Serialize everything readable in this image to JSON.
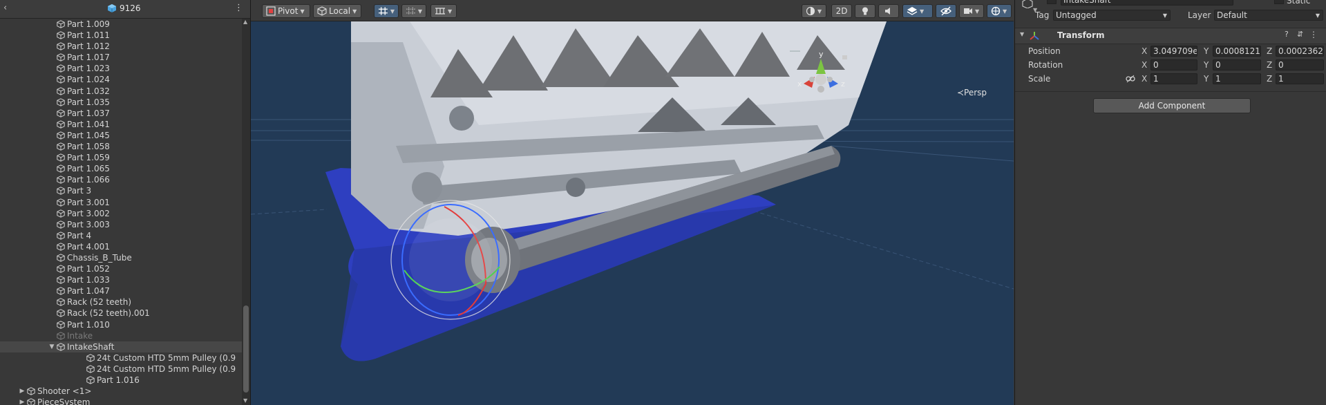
{
  "hierarchy": {
    "title": "9126",
    "back_glyph": "‹",
    "menu_glyph": "⋮",
    "rows": [
      {
        "label": "Part 1.009",
        "indent": 2,
        "expand": "none",
        "selected": false,
        "dim": false
      },
      {
        "label": "Part 1.011",
        "indent": 2,
        "expand": "none",
        "selected": false,
        "dim": false
      },
      {
        "label": "Part 1.012",
        "indent": 2,
        "expand": "none",
        "selected": false,
        "dim": false
      },
      {
        "label": "Part 1.017",
        "indent": 2,
        "expand": "none",
        "selected": false,
        "dim": false
      },
      {
        "label": "Part 1.023",
        "indent": 2,
        "expand": "none",
        "selected": false,
        "dim": false
      },
      {
        "label": "Part 1.024",
        "indent": 2,
        "expand": "none",
        "selected": false,
        "dim": false
      },
      {
        "label": "Part 1.032",
        "indent": 2,
        "expand": "none",
        "selected": false,
        "dim": false
      },
      {
        "label": "Part 1.035",
        "indent": 2,
        "expand": "none",
        "selected": false,
        "dim": false
      },
      {
        "label": "Part 1.037",
        "indent": 2,
        "expand": "none",
        "selected": false,
        "dim": false
      },
      {
        "label": "Part 1.041",
        "indent": 2,
        "expand": "none",
        "selected": false,
        "dim": false
      },
      {
        "label": "Part 1.045",
        "indent": 2,
        "expand": "none",
        "selected": false,
        "dim": false
      },
      {
        "label": "Part 1.058",
        "indent": 2,
        "expand": "none",
        "selected": false,
        "dim": false
      },
      {
        "label": "Part 1.059",
        "indent": 2,
        "expand": "none",
        "selected": false,
        "dim": false
      },
      {
        "label": "Part 1.065",
        "indent": 2,
        "expand": "none",
        "selected": false,
        "dim": false
      },
      {
        "label": "Part 1.066",
        "indent": 2,
        "expand": "none",
        "selected": false,
        "dim": false
      },
      {
        "label": "Part 3",
        "indent": 2,
        "expand": "none",
        "selected": false,
        "dim": false
      },
      {
        "label": "Part 3.001",
        "indent": 2,
        "expand": "none",
        "selected": false,
        "dim": false
      },
      {
        "label": "Part 3.002",
        "indent": 2,
        "expand": "none",
        "selected": false,
        "dim": false
      },
      {
        "label": "Part 3.003",
        "indent": 2,
        "expand": "none",
        "selected": false,
        "dim": false
      },
      {
        "label": "Part 4",
        "indent": 2,
        "expand": "none",
        "selected": false,
        "dim": false
      },
      {
        "label": "Part 4.001",
        "indent": 2,
        "expand": "none",
        "selected": false,
        "dim": false
      },
      {
        "label": "Chassis_B_Tube",
        "indent": 2,
        "expand": "none",
        "selected": false,
        "dim": false
      },
      {
        "label": "Part 1.052",
        "indent": 2,
        "expand": "none",
        "selected": false,
        "dim": false
      },
      {
        "label": "Part 1.033",
        "indent": 2,
        "expand": "none",
        "selected": false,
        "dim": false
      },
      {
        "label": "Part 1.047",
        "indent": 2,
        "expand": "none",
        "selected": false,
        "dim": false
      },
      {
        "label": "Rack (52 teeth)",
        "indent": 2,
        "expand": "none",
        "selected": false,
        "dim": false
      },
      {
        "label": "Rack (52 teeth).001",
        "indent": 2,
        "expand": "none",
        "selected": false,
        "dim": false
      },
      {
        "label": "Part 1.010",
        "indent": 2,
        "expand": "none",
        "selected": false,
        "dim": false
      },
      {
        "label": "Intake",
        "indent": 2,
        "expand": "none",
        "selected": false,
        "dim": true
      },
      {
        "label": "IntakeShaft",
        "indent": 2,
        "expand": "expanded",
        "selected": true,
        "dim": false
      },
      {
        "label": "24t Custom HTD 5mm Pulley (0.9",
        "indent": 3,
        "expand": "none",
        "selected": false,
        "dim": false
      },
      {
        "label": "24t Custom HTD 5mm Pulley (0.9",
        "indent": 3,
        "expand": "none",
        "selected": false,
        "dim": false
      },
      {
        "label": "Part 1.016",
        "indent": 3,
        "expand": "none",
        "selected": false,
        "dim": false
      },
      {
        "label": "Shooter <1>",
        "indent": 1,
        "expand": "collapsed",
        "selected": false,
        "dim": false
      },
      {
        "label": "PieceSystem",
        "indent": 1,
        "expand": "collapsed",
        "selected": false,
        "dim": false
      }
    ]
  },
  "scene": {
    "toolbar": {
      "pivot_label": "Pivot",
      "local_label": "Local",
      "mode_2d_label": "2D"
    },
    "persp_label": "≺Persp",
    "gizmo_axes": {
      "x": "x",
      "y": "y",
      "z": "z"
    },
    "colors": {
      "background": "#223a56",
      "ground": "#2e3fc0",
      "model": "#c9ced6"
    }
  },
  "inspector": {
    "object_name": "IntakeShaft",
    "static_label": "Static",
    "tag_label": "Tag",
    "tag_value": "Untagged",
    "layer_label": "Layer",
    "layer_value": "Default",
    "transform": {
      "title": "Transform",
      "position": {
        "label": "Position",
        "x": "3.049709e",
        "y": "0.0008121€",
        "z": "0.0002362"
      },
      "rotation": {
        "label": "Rotation",
        "x": "0",
        "y": "0",
        "z": "0"
      },
      "scale": {
        "label": "Scale",
        "x": "1",
        "y": "1",
        "z": "1"
      },
      "axis_x": "X",
      "axis_y": "Y",
      "axis_z": "Z"
    },
    "add_component_label": "Add Component"
  }
}
